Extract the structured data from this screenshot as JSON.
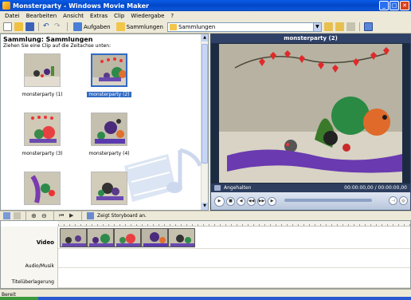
{
  "window": {
    "title": "Monsterparty - Windows Movie Maker"
  },
  "menu": [
    "Datei",
    "Bearbeiten",
    "Ansicht",
    "Extras",
    "Clip",
    "Wiedergabe",
    "?"
  ],
  "toolbar": {
    "tasks_label": "Aufgaben",
    "collections_label": "Sammlungen",
    "collection_select_value": "Sammlungen"
  },
  "collection": {
    "title": "Sammlung: Sammlungen",
    "hint": "Ziehen Sie eine Clip auf die Zeitachse unten:",
    "clips": [
      {
        "label": "monsterparty (1)",
        "selected": false
      },
      {
        "label": "monsterparty (2)",
        "selected": true
      },
      {
        "label": "monsterparty (3)",
        "selected": false
      },
      {
        "label": "monsterparty (4)",
        "selected": false
      },
      {
        "label": "",
        "selected": false
      },
      {
        "label": "",
        "selected": false
      }
    ]
  },
  "monitor": {
    "title": "monsterparty (2)",
    "status": "Angehalten",
    "time": "00:00:00,00 / 00:00:00,00"
  },
  "storyboard": {
    "toggle_label": "Zeigt Storyboard an."
  },
  "timeline": {
    "tracks": {
      "video": "Video",
      "audio": "Audio/Musik",
      "title": "Titelüberlagerung"
    },
    "clip_count": 5
  },
  "status": {
    "text": "Bereit"
  },
  "colors": {
    "titlebar": "#0346c8",
    "selection": "#316ac5",
    "monitor_bg": "#1c2b40"
  }
}
